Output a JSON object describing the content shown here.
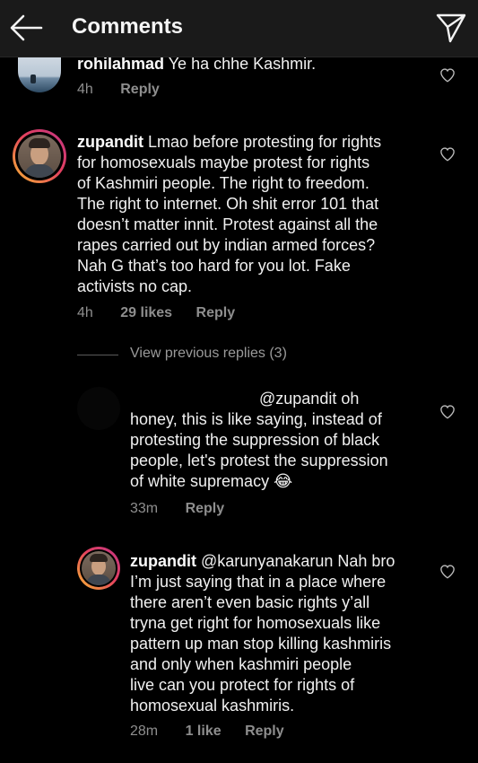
{
  "header": {
    "title": "Comments"
  },
  "comments": [
    {
      "username": "rohilahmad",
      "text": "Ye ha chhe Kashmir.",
      "time": "4h",
      "reply": "Reply"
    },
    {
      "username": "zupandit",
      "text": "Lmao before protesting for rights for homosexuals maybe protest for rights of Kashmiri people. The right to freedom. The right to internet. Oh shit error 101 that doesn’t matter innit. Protest against all the rapes carried out by indian armed forces? Nah G that’s too hard for you lot. Fake activists no cap.",
      "lines": [
        "Lmao before protesting for rights",
        "for homosexuals maybe protest for rights",
        "of Kashmiri people. The right to freedom.",
        "The right to internet. Oh shit error 101 that",
        "doesn’t matter innit. Protest against all the",
        "rapes carried out by indian armed forces?",
        "Nah G that’s too hard for you lot. Fake",
        "activists no cap."
      ],
      "time": "4h",
      "likes": "29 likes",
      "reply": "Reply"
    }
  ],
  "view_previous": "View previous replies (3)",
  "replies": [
    {
      "mention": "@zupandit",
      "lines_first": "oh",
      "lines": [
        "honey, this is like saying, instead of",
        "protesting the suppression of black",
        "people, let's protest the suppression",
        "of white supremacy 😂"
      ],
      "time": "33m",
      "reply": "Reply"
    },
    {
      "username": "zupandit",
      "mention": "@karunyanakarun",
      "first_rest": "Nah bro",
      "lines": [
        "I’m just saying that in a place where",
        "there aren’t even basic rights y’all",
        "tryna get right for homosexuals like",
        "pattern up man stop killing kashmiris",
        "and only when kashmiri people",
        "live can you protect for rights of",
        "homosexual kashmiris."
      ],
      "time": "28m",
      "likes": "1 like",
      "reply": "Reply"
    }
  ],
  "icons": {
    "back": "back-arrow-icon",
    "send": "send-icon",
    "heart": "heart-icon"
  },
  "colors": {
    "background": "#000000",
    "header": "#1a1a1a",
    "meta_text": "#8e8e8e",
    "story_ring_start": "#f7b733",
    "story_ring_end": "#c13584"
  }
}
